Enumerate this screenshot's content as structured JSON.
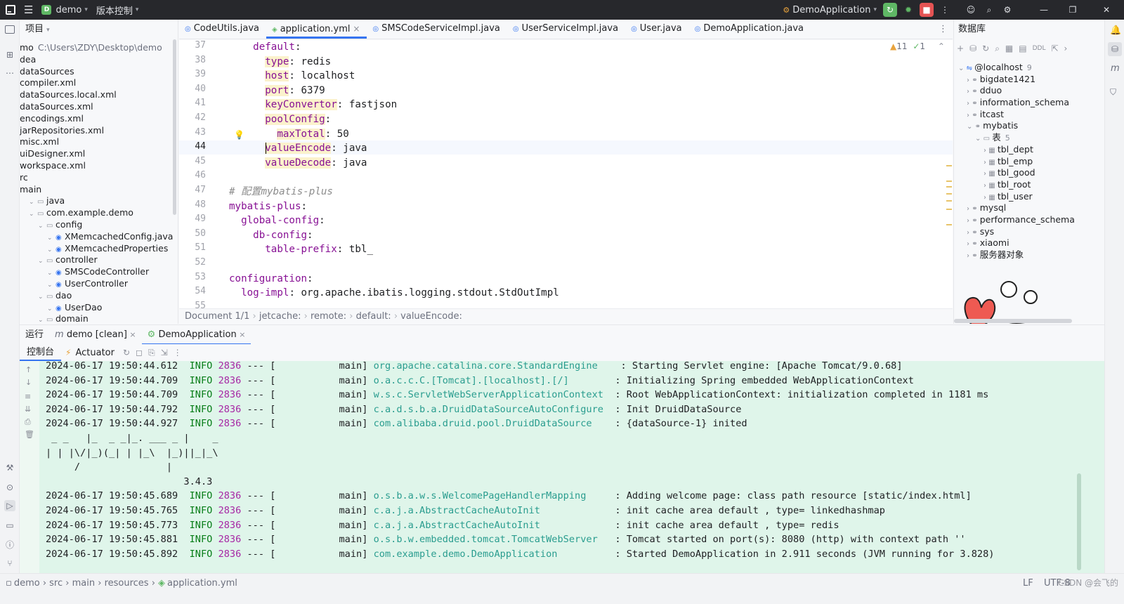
{
  "titlebar": {
    "project": "demo",
    "vcs": "版本控制",
    "run_config": "DemoApplication"
  },
  "colors": {
    "accent": "#3574f0",
    "keyword": "#871094",
    "console_bg": "#dff5ea",
    "run_green": "#5fb865",
    "stop_red": "#e55353"
  },
  "project_panel": {
    "title": "项目",
    "rows": [
      {
        "name": "mo",
        "extra": "C:\\Users\\ZDY\\Desktop\\demo",
        "indent": 0
      },
      {
        "name": "dea",
        "indent": 0
      },
      {
        "name": "dataSources",
        "indent": 0
      },
      {
        "name": "compiler.xml",
        "indent": 0
      },
      {
        "name": "dataSources.local.xml",
        "indent": 0
      },
      {
        "name": "dataSources.xml",
        "indent": 0
      },
      {
        "name": "encodings.xml",
        "indent": 0
      },
      {
        "name": "jarRepositories.xml",
        "indent": 0
      },
      {
        "name": "misc.xml",
        "indent": 0
      },
      {
        "name": "uiDesigner.xml",
        "indent": 0
      },
      {
        "name": "workspace.xml",
        "indent": 0
      },
      {
        "name": "rc",
        "indent": 0
      },
      {
        "name": "main",
        "indent": 0
      },
      {
        "name": "java",
        "indent": 1
      },
      {
        "name": "com.example.demo",
        "indent": 1
      },
      {
        "name": "config",
        "indent": 2
      },
      {
        "name": "XMemcachedConfig.java",
        "indent": 3
      },
      {
        "name": "XMemcachedProperties",
        "indent": 3
      },
      {
        "name": "controller",
        "indent": 2
      },
      {
        "name": "SMSCodeController",
        "indent": 3
      },
      {
        "name": "UserController",
        "indent": 3
      },
      {
        "name": "dao",
        "indent": 2
      },
      {
        "name": "UserDao",
        "indent": 3
      },
      {
        "name": "domain",
        "indent": 2
      }
    ]
  },
  "editor": {
    "tabs": [
      {
        "label": "CodeUtils.java",
        "active": false
      },
      {
        "label": "application.yml",
        "active": true
      },
      {
        "label": "SMSCodeServiceImpl.java",
        "active": false
      },
      {
        "label": "UserServiceImpl.java",
        "active": false
      },
      {
        "label": "User.java",
        "active": false
      },
      {
        "label": "DemoApplication.java",
        "active": false
      }
    ],
    "inspections": {
      "warnings": "11",
      "checks": "1"
    },
    "lines": [
      {
        "n": "37",
        "parts": [
          [
            "",
            "    "
          ],
          [
            "k",
            "default"
          ],
          [
            "",
            ":"
          ]
        ]
      },
      {
        "n": "38",
        "parts": [
          [
            "",
            "      "
          ],
          [
            "kh",
            "type"
          ],
          [
            "",
            ": redis"
          ]
        ]
      },
      {
        "n": "39",
        "parts": [
          [
            "",
            "      "
          ],
          [
            "kh",
            "host"
          ],
          [
            "",
            ": localhost"
          ]
        ]
      },
      {
        "n": "40",
        "parts": [
          [
            "",
            "      "
          ],
          [
            "kh",
            "port"
          ],
          [
            "",
            ": 6379"
          ]
        ]
      },
      {
        "n": "41",
        "parts": [
          [
            "",
            "      "
          ],
          [
            "kh",
            "keyConvertor"
          ],
          [
            "",
            ": fastjson"
          ]
        ]
      },
      {
        "n": "42",
        "parts": [
          [
            "",
            "      "
          ],
          [
            "kh",
            "poolConfig"
          ],
          [
            "",
            ":"
          ]
        ]
      },
      {
        "n": "43",
        "parts": [
          [
            "",
            "        "
          ],
          [
            "kh",
            "maxTotal"
          ],
          [
            "",
            ": 50"
          ]
        ]
      },
      {
        "n": "44",
        "parts": [
          [
            "",
            "      "
          ],
          [
            "kh",
            "valueEncode"
          ],
          [
            "",
            ": java"
          ]
        ]
      },
      {
        "n": "45",
        "parts": [
          [
            "",
            "      "
          ],
          [
            "kh",
            "valueDecode"
          ],
          [
            "",
            ": java"
          ]
        ]
      },
      {
        "n": "46",
        "parts": []
      },
      {
        "n": "47",
        "parts": [
          [
            "c",
            "# 配置mybatis-plus"
          ]
        ]
      },
      {
        "n": "48",
        "parts": [
          [
            "k",
            "mybatis-plus"
          ],
          [
            "",
            ":"
          ]
        ]
      },
      {
        "n": "49",
        "parts": [
          [
            "",
            "  "
          ],
          [
            "k",
            "global-config"
          ],
          [
            "",
            ":"
          ]
        ]
      },
      {
        "n": "50",
        "parts": [
          [
            "",
            "    "
          ],
          [
            "k",
            "db-config"
          ],
          [
            "",
            ":"
          ]
        ]
      },
      {
        "n": "51",
        "parts": [
          [
            "",
            "      "
          ],
          [
            "k",
            "table-prefix"
          ],
          [
            "",
            ": tbl_"
          ]
        ]
      },
      {
        "n": "52",
        "parts": []
      },
      {
        "n": "53",
        "parts": [
          [
            "k",
            "configuration"
          ],
          [
            "",
            ":"
          ]
        ]
      },
      {
        "n": "54",
        "parts": [
          [
            "",
            "  "
          ],
          [
            "k",
            "log-impl"
          ],
          [
            "",
            ": org.apache.ibatis.logging.stdout.StdOutImpl"
          ]
        ]
      },
      {
        "n": "55",
        "parts": []
      }
    ],
    "breadcrumb": [
      "Document 1/1",
      "jetcache:",
      "remote:",
      "default:",
      "valueEncode:"
    ]
  },
  "database_panel": {
    "title": "数据库",
    "rows": [
      {
        "label": "@localhost",
        "count": "9",
        "indent": 0,
        "open": true
      },
      {
        "label": "bigdate1421",
        "indent": 1
      },
      {
        "label": "dduo",
        "indent": 1
      },
      {
        "label": "information_schema",
        "indent": 1
      },
      {
        "label": "itcast",
        "indent": 1
      },
      {
        "label": "mybatis",
        "indent": 1,
        "open": true
      },
      {
        "label": "表",
        "count": "5",
        "indent": 2,
        "open": true
      },
      {
        "label": "tbl_dept",
        "indent": 3
      },
      {
        "label": "tbl_emp",
        "indent": 3
      },
      {
        "label": "tbl_good",
        "indent": 3
      },
      {
        "label": "tbl_root",
        "indent": 3
      },
      {
        "label": "tbl_user",
        "indent": 3
      },
      {
        "label": "mysql",
        "indent": 1
      },
      {
        "label": "performance_schema",
        "indent": 1
      },
      {
        "label": "sys",
        "indent": 1
      },
      {
        "label": "xiaomi",
        "indent": 1
      },
      {
        "label": "服务器对象",
        "indent": 1
      }
    ]
  },
  "run_panel": {
    "title": "运行",
    "tabs": [
      {
        "label": "demo [clean]"
      },
      {
        "label": "DemoApplication"
      }
    ],
    "console_tab": "控制台",
    "actuator_tab": "Actuator",
    "logs": [
      {
        "ts": "2024-06-17 19:50:44.612",
        "level": "INFO",
        "pid": "2836",
        "thread": "main",
        "cls": "org.apache.catalina.core.StandardEngine   ",
        "msg": "Starting Servlet engine: [Apache Tomcat/9.0.68]"
      },
      {
        "ts": "2024-06-17 19:50:44.709",
        "level": "INFO",
        "pid": "2836",
        "thread": "main",
        "cls": "o.a.c.c.C.[Tomcat].[localhost].[/]       ",
        "msg": "Initializing Spring embedded WebApplicationContext"
      },
      {
        "ts": "2024-06-17 19:50:44.709",
        "level": "INFO",
        "pid": "2836",
        "thread": "main",
        "cls": "w.s.c.ServletWebServerApplicationContext ",
        "msg": "Root WebApplicationContext: initialization completed in 1181 ms"
      },
      {
        "ts": "2024-06-17 19:50:44.792",
        "level": "INFO",
        "pid": "2836",
        "thread": "main",
        "cls": "c.a.d.s.b.a.DruidDataSourceAutoConfigure ",
        "msg": "Init DruidDataSource"
      },
      {
        "ts": "2024-06-17 19:50:44.927",
        "level": "INFO",
        "pid": "2836",
        "thread": "main",
        "cls": "com.alibaba.druid.pool.DruidDataSource   ",
        "msg": "{dataSource-1} inited"
      },
      {
        "ts": "2024-06-17 19:50:45.689",
        "level": "INFO",
        "pid": "2836",
        "thread": "main",
        "cls": "o.s.b.a.w.s.WelcomePageHandlerMapping    ",
        "msg": "Adding welcome page: class path resource [static/index.html]"
      },
      {
        "ts": "2024-06-17 19:50:45.765",
        "level": "INFO",
        "pid": "2836",
        "thread": "main",
        "cls": "c.a.j.a.AbstractCacheAutoInit            ",
        "msg": "init cache area default , type= linkedhashmap"
      },
      {
        "ts": "2024-06-17 19:50:45.773",
        "level": "INFO",
        "pid": "2836",
        "thread": "main",
        "cls": "c.a.j.a.AbstractCacheAutoInit            ",
        "msg": "init cache area default , type= redis"
      },
      {
        "ts": "2024-06-17 19:50:45.881",
        "level": "INFO",
        "pid": "2836",
        "thread": "main",
        "cls": "o.s.b.w.embedded.tomcat.TomcatWebServer  ",
        "msg": "Tomcat started on port(s): 8080 (http) with context path ''"
      },
      {
        "ts": "2024-06-17 19:50:45.892",
        "level": "INFO",
        "pid": "2836",
        "thread": "main",
        "cls": "com.example.demo.DemoApplication         ",
        "msg": "Started DemoApplication in 2.911 seconds (JVM running for 3.828)"
      }
    ],
    "banner": [
      " _ _   |_  _ _|_. ___ _ |    _ ",
      "| | |\\/|_)(_| | |_\\  |_)||_|_\\ ",
      "     /               |",
      "                        3.4.3"
    ]
  },
  "status_bar": {
    "path": [
      "demo",
      "src",
      "main",
      "resources",
      "application.yml"
    ],
    "line_sep": "LF",
    "encoding": "UTF-8",
    "watermark": "CSDN @会飞的"
  }
}
